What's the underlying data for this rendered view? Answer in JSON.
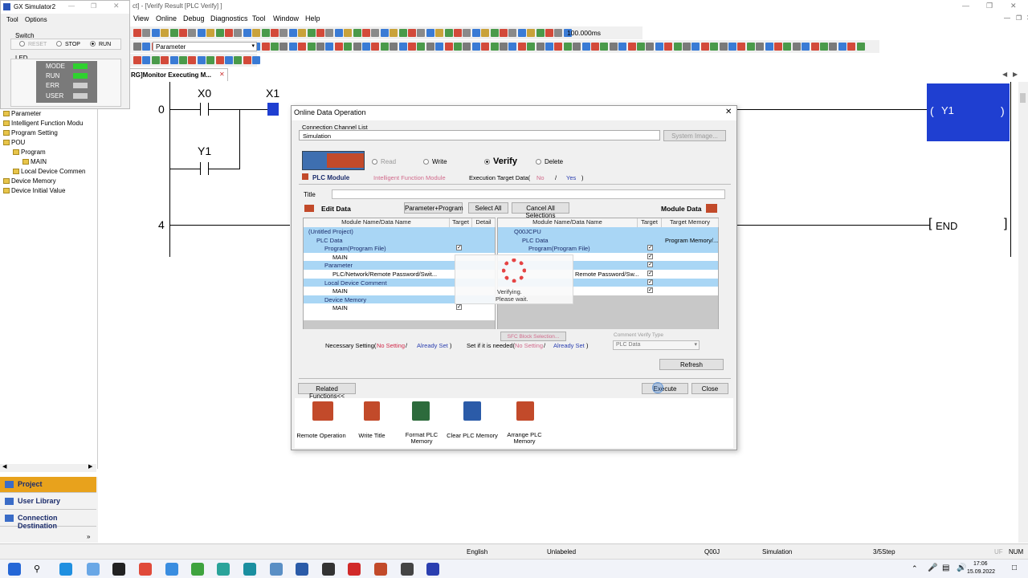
{
  "app": {
    "title": "ct] - [Verify Result [PLC Verify] ]"
  },
  "menu": [
    "View",
    "Online",
    "Debug",
    "Diagnostics",
    "Tool",
    "Window",
    "Help"
  ],
  "toolbar": {
    "interval": "100.000ms",
    "parameter_combo": "Parameter"
  },
  "tab": {
    "label": "[PRG]Monitor Executing M...",
    "tab_prefix": "RG]Monitor Executing M..."
  },
  "simulator": {
    "title": "GX Simulator2",
    "menu": [
      "Tool",
      "Options"
    ],
    "switch_label": "Switch",
    "switch_options": [
      "RESET",
      "STOP",
      "RUN"
    ],
    "switch_selected": "RUN",
    "led_label": "LED",
    "leds": [
      {
        "name": "MODE",
        "color": "#2fd12f"
      },
      {
        "name": "RUN",
        "color": "#2fd12f"
      },
      {
        "name": "ERR",
        "color": "#cfcfcf"
      },
      {
        "name": "USER",
        "color": "#cfcfcf"
      }
    ]
  },
  "nav_tree": [
    {
      "label": "Parameter",
      "indent": 0
    },
    {
      "label": "Intelligent Function Modu",
      "indent": 0
    },
    {
      "label": "Program Setting",
      "indent": 0
    },
    {
      "label": "POU",
      "indent": 0
    },
    {
      "label": "Program",
      "indent": 1
    },
    {
      "label": "MAIN",
      "indent": 2
    },
    {
      "label": "Local Device Commen",
      "indent": 1
    },
    {
      "label": "Device Memory",
      "indent": 0
    },
    {
      "label": "Device Initial Value",
      "indent": 0
    }
  ],
  "nav_panels": [
    "Project",
    "User Library",
    "Connection Destination"
  ],
  "ladder": {
    "step0": "0",
    "step4": "4",
    "contact1": "X0",
    "contact2": "X1",
    "contact3": "Y1",
    "coil": "Y1",
    "end": "END"
  },
  "dialog": {
    "title": "Online Data Operation",
    "conn_label": "Connection Channel List",
    "conn_value": "Simulation",
    "system_image": "System Image...",
    "ops": {
      "read": "Read",
      "write": "Write",
      "verify": "Verify",
      "delete": "Delete",
      "selected": "Verify"
    },
    "tabs": {
      "plc_module": "PLC Module",
      "intelligent": "Intelligent Function Module"
    },
    "exec_target": "Execution Target Data(",
    "exec_no": "No",
    "exec_slash": "/",
    "exec_yes": "Yes",
    "exec_close": ")",
    "title_label": "Title",
    "edit_data": "Edit Data",
    "module_data": "Module Data",
    "btn_param_prog": "Parameter+Program",
    "btn_select_all": "Select All",
    "btn_cancel_all": "Cancel All Selections",
    "left_headers": [
      "Module Name/Data Name",
      "Target",
      "Detail"
    ],
    "right_headers": [
      "Module Name/Data Name",
      "Target",
      "Target Memory"
    ],
    "left_rows": [
      {
        "label": "(Untitled Project)",
        "indent": 0,
        "sel": true,
        "check": false
      },
      {
        "label": "PLC Data",
        "indent": 1,
        "sel": true,
        "check": false
      },
      {
        "label": "Program(Program File)",
        "indent": 2,
        "sel": true,
        "check": true
      },
      {
        "label": "MAIN",
        "indent": 3,
        "sel": false,
        "check": false
      },
      {
        "label": "Parameter",
        "indent": 2,
        "sel": true,
        "check": false
      },
      {
        "label": "PLC/Network/Remote Password/Swit...",
        "indent": 3,
        "sel": false,
        "check": false
      },
      {
        "label": "Local Device Comment",
        "indent": 2,
        "sel": true,
        "check": false
      },
      {
        "label": "MAIN",
        "indent": 3,
        "sel": false,
        "check": false
      },
      {
        "label": "Device Memory",
        "indent": 2,
        "sel": true,
        "check": false
      },
      {
        "label": "MAIN",
        "indent": 3,
        "sel": false,
        "check": true
      }
    ],
    "right_rows": [
      {
        "label": "Q00JCPU",
        "sel": true,
        "memory": "",
        "check": false
      },
      {
        "label": "PLC Data",
        "sel": true,
        "memory": "Program Memory/...",
        "check": false
      },
      {
        "label": "Program(Program File)",
        "sel": true,
        "memory": "",
        "check": true
      },
      {
        "label": "",
        "sel": false,
        "memory": "",
        "check": true
      },
      {
        "label": "",
        "sel": true,
        "memory": "",
        "check": true
      },
      {
        "label": "Remote Password/Sw...",
        "sel": false,
        "memory": "",
        "check": true
      },
      {
        "label": "",
        "sel": true,
        "memory": "",
        "check": true
      },
      {
        "label": "",
        "sel": false,
        "memory": "",
        "check": true
      }
    ],
    "verifying_line1": "Verifying.",
    "verifying_line2": "Please wait.",
    "sfc_block": "SFC Block Selection...",
    "comment_verify_type": "Comment Verify Type",
    "plc_data_combo": "PLC Data",
    "necessary": "Necessary Setting(",
    "no_setting": "No Setting",
    "slash": "/",
    "already_set": "Already Set",
    "close_paren": ")",
    "set_if_needed": "Set if it is needed(",
    "refresh": "Refresh",
    "related": "Related Functions<<",
    "execute": "Execute",
    "close": "Close",
    "related_items": [
      "Remote Operation",
      "Write Title",
      "Format PLC Memory",
      "Clear PLC Memory",
      "Arrange PLC Memory"
    ]
  },
  "status": {
    "lang": "English",
    "label": "Unlabeled",
    "cpu": "Q00J",
    "conn": "Simulation",
    "step": "3/5Step",
    "ovr": "UF",
    "num": "NUM"
  },
  "taskbar": {
    "time": "17:06",
    "date": "15.09.2022"
  }
}
